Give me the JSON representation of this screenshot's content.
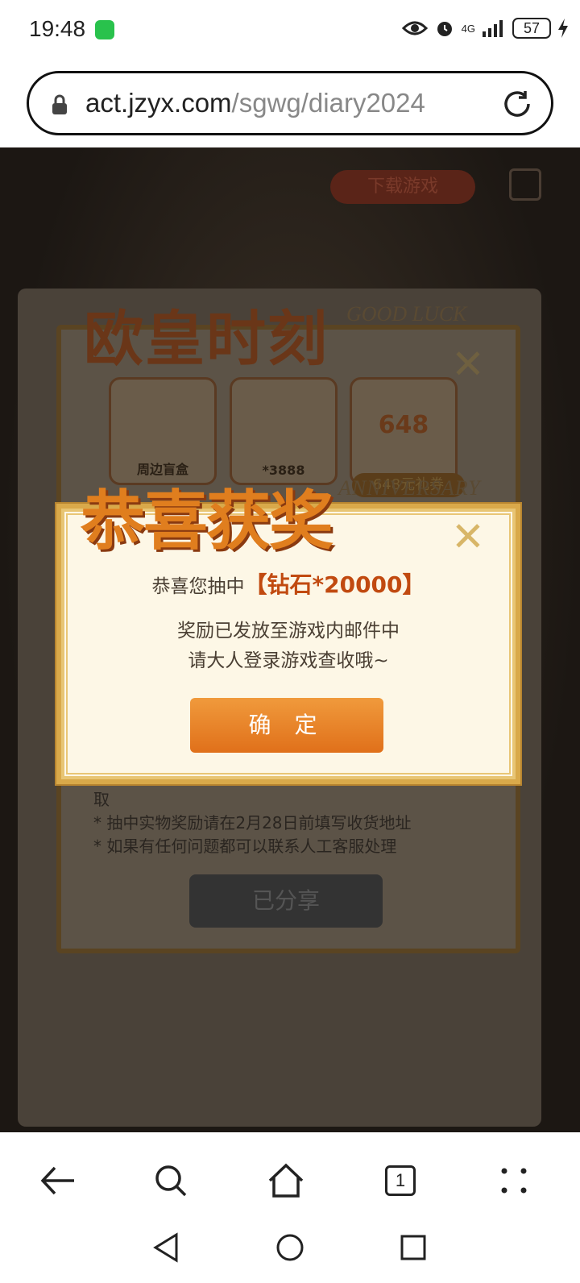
{
  "status_bar": {
    "time": "19:48",
    "network": "4G",
    "battery": "57",
    "icons": [
      "wechat-icon",
      "eye-icon",
      "alarm-icon",
      "signal-icon",
      "battery-icon",
      "charging-icon"
    ]
  },
  "browser": {
    "url_host": "act.jzyx.com",
    "url_path": "/sgwg/diary2024"
  },
  "page": {
    "download_button": "下载游戏",
    "card_title": "欧皇时刻",
    "card_subtitle": "GOOD LUCK",
    "anniversary": "ANNIVERSARY",
    "prizes": [
      {
        "label": "周边盲盒"
      },
      {
        "label": "*3888"
      },
      {
        "label": "648",
        "badge": "648元礼券"
      }
    ],
    "rules": [
      "取",
      "* 抽中实物奖励请在2月28日前填写收货地址",
      "* 如果有任何问题都可以联系人工客服处理"
    ],
    "shared_button": "已分享"
  },
  "modal": {
    "title": "恭喜获奖",
    "line1_prefix": "恭喜您抽中",
    "line1_prize": "【钻石*20000】",
    "line2": "奖励已发放至游戏内邮件中",
    "line3": "请大人登录游戏查收哦~",
    "confirm": "确 定"
  },
  "bottom_nav": {
    "tab_count": "1"
  },
  "colors": {
    "accent_orange": "#e0701a",
    "modal_bg": "#fdf7e6",
    "gold_border": "#d9a94a"
  }
}
